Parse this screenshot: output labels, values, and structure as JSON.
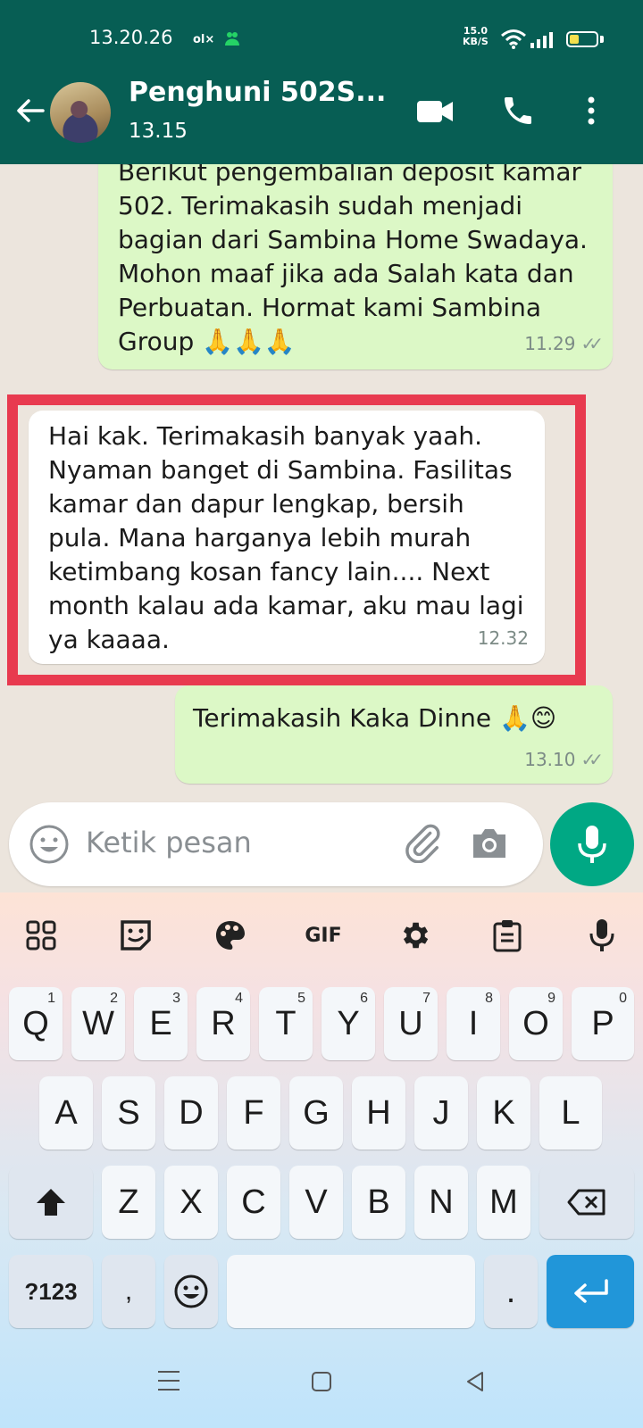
{
  "status_bar": {
    "time": "13.20.26",
    "net_speed_value": "15.0",
    "net_speed_unit": "KB/S"
  },
  "header": {
    "contact_name": "Penghuni 502S...",
    "status": "13.15"
  },
  "messages": [
    {
      "direction": "outgoing",
      "text": "Berikut pengembalian deposit kamar\n502. Terimakasih sudah menjadi\nbagian dari Sambina Home Swadaya.\nMohon maaf jika ada Salah kata dan\nPerbuatan. Hormat kami Sambina\nGroup 🙏🙏🙏",
      "time": "11.29",
      "read": true
    },
    {
      "direction": "incoming",
      "text": "Hai kak. Terimakasih banyak yaah.\nNyaman banget di Sambina. Fasilitas\nkamar dan dapur lengkap, bersih\npula. Mana harganya lebih murah\nketimbang kosan fancy lain.... Next\nmonth kalau ada kamar, aku mau lagi\nya kaaaa.",
      "time": "12.32",
      "highlighted": true
    },
    {
      "direction": "outgoing",
      "text": "Terimakasih Kaka Dinne 🙏😊",
      "time": "13.10",
      "read": true
    }
  ],
  "composer": {
    "placeholder": "Ketik pesan"
  },
  "keyboard": {
    "toolbar": [
      "apps-icon",
      "sticker-icon",
      "palette-icon",
      "GIF",
      "settings-icon",
      "clipboard-icon",
      "mic-icon"
    ],
    "row1": [
      {
        "key": "Q",
        "num": "1"
      },
      {
        "key": "W",
        "num": "2"
      },
      {
        "key": "E",
        "num": "3"
      },
      {
        "key": "R",
        "num": "4"
      },
      {
        "key": "T",
        "num": "5"
      },
      {
        "key": "Y",
        "num": "6"
      },
      {
        "key": "U",
        "num": "7"
      },
      {
        "key": "I",
        "num": "8"
      },
      {
        "key": "O",
        "num": "9"
      },
      {
        "key": "P",
        "num": "0"
      }
    ],
    "row2": [
      "A",
      "S",
      "D",
      "F",
      "G",
      "H",
      "J",
      "K",
      "L"
    ],
    "row3": [
      "Z",
      "X",
      "C",
      "V",
      "B",
      "N",
      "M"
    ],
    "bottom": {
      "symbols": "?123",
      "comma": ",",
      "period": "."
    }
  },
  "colors": {
    "header": "#075e54",
    "outgoing_bubble": "#dcf8c6",
    "incoming_bubble": "#ffffff",
    "highlight_border": "#e83a4f",
    "mic_button": "#00a884",
    "enter_key": "#2196d9"
  }
}
